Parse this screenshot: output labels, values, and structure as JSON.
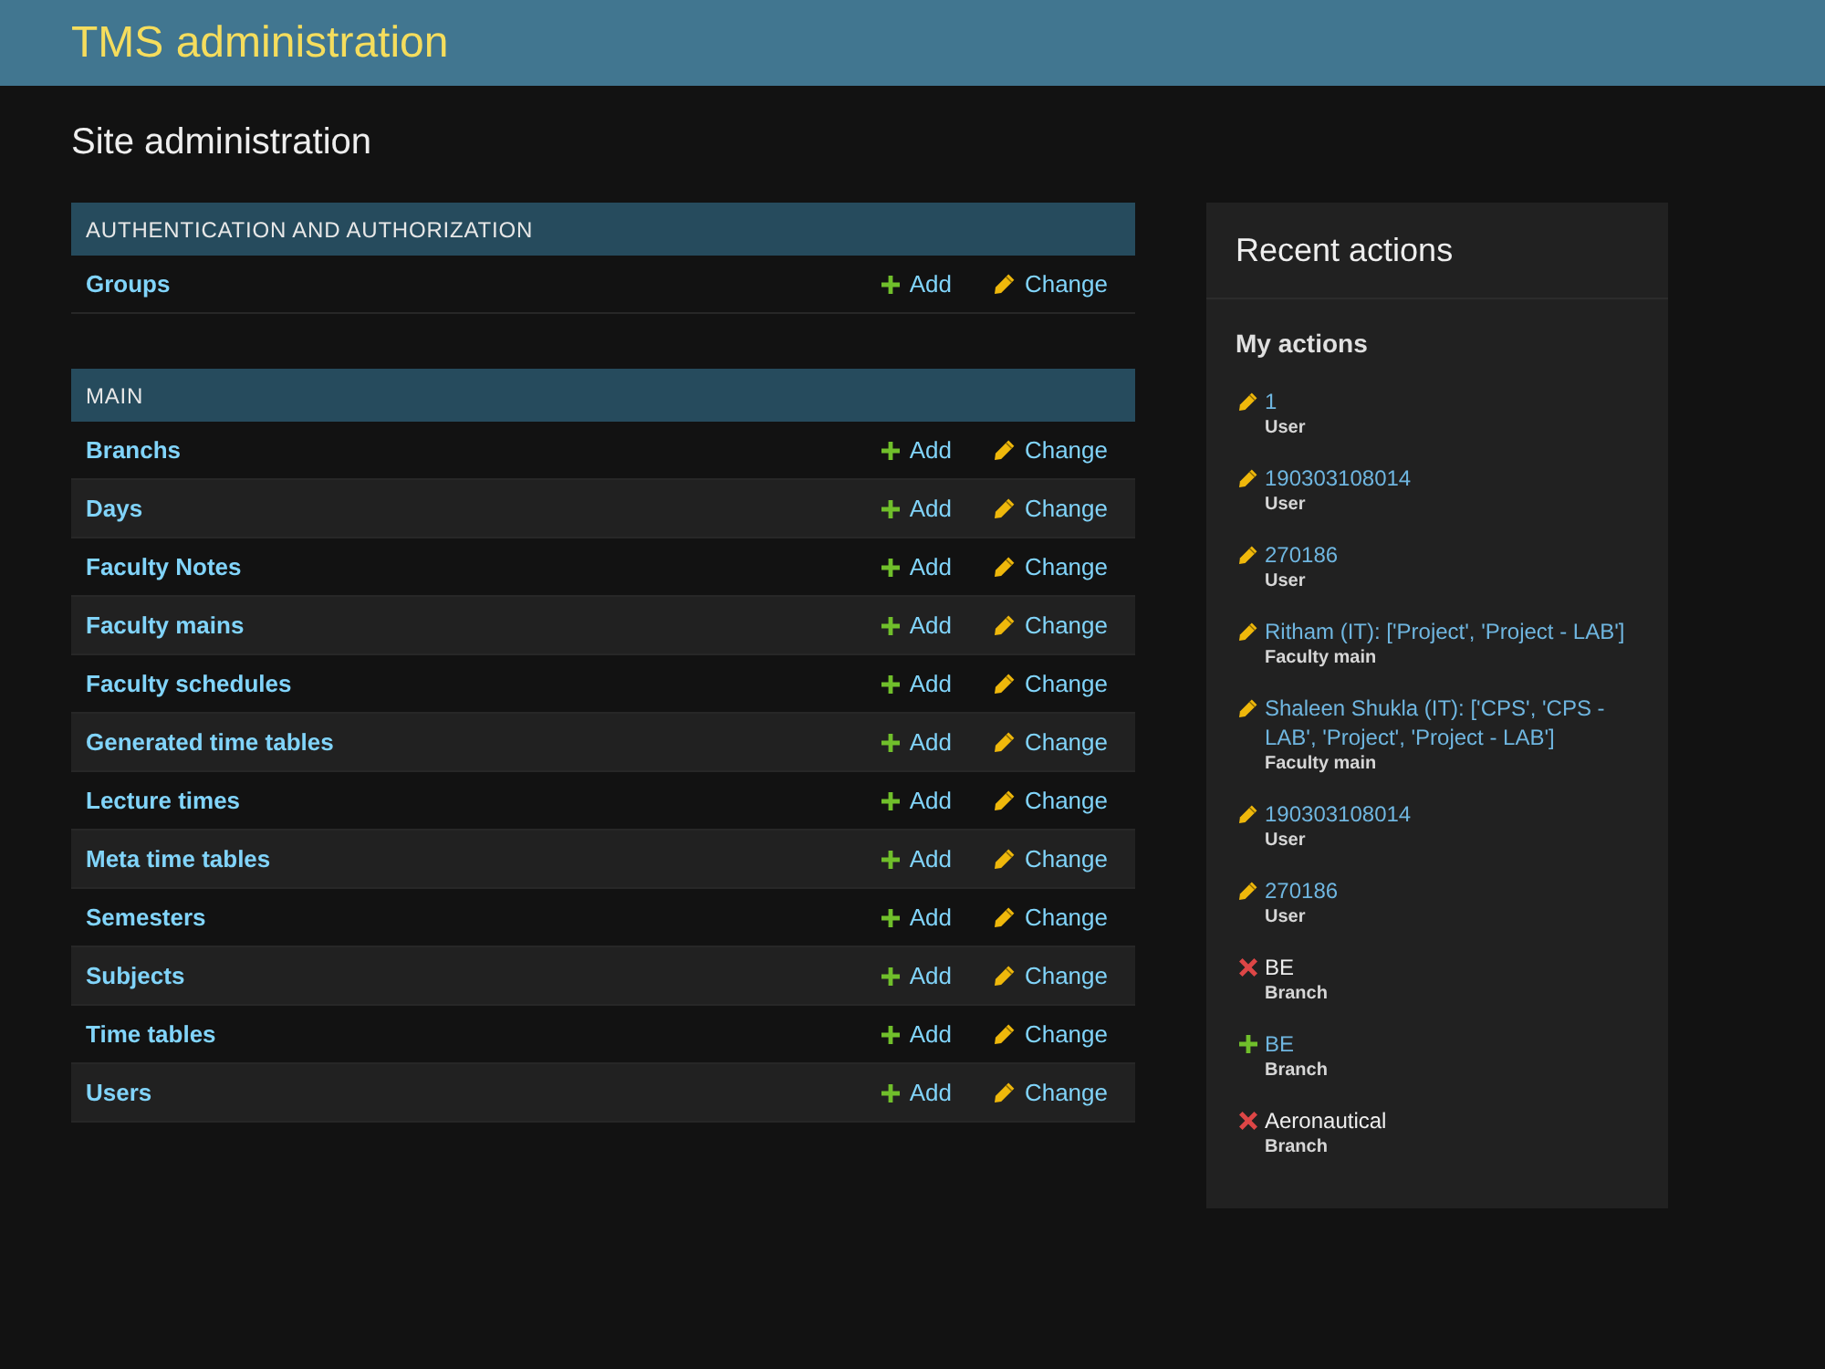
{
  "header": {
    "title": "TMS administration"
  },
  "page_title": "Site administration",
  "modules": [
    {
      "caption": "AUTHENTICATION AND AUTHORIZATION",
      "rows": [
        {
          "name": "Groups",
          "add": "Add",
          "change": "Change"
        }
      ]
    },
    {
      "caption": "MAIN",
      "rows": [
        {
          "name": "Branchs",
          "add": "Add",
          "change": "Change"
        },
        {
          "name": "Days",
          "add": "Add",
          "change": "Change"
        },
        {
          "name": "Faculty Notes",
          "add": "Add",
          "change": "Change"
        },
        {
          "name": "Faculty mains",
          "add": "Add",
          "change": "Change"
        },
        {
          "name": "Faculty schedules",
          "add": "Add",
          "change": "Change"
        },
        {
          "name": "Generated time tables",
          "add": "Add",
          "change": "Change"
        },
        {
          "name": "Lecture times",
          "add": "Add",
          "change": "Change"
        },
        {
          "name": "Meta time tables",
          "add": "Add",
          "change": "Change"
        },
        {
          "name": "Semesters",
          "add": "Add",
          "change": "Change"
        },
        {
          "name": "Subjects",
          "add": "Add",
          "change": "Change"
        },
        {
          "name": "Time tables",
          "add": "Add",
          "change": "Change"
        },
        {
          "name": "Users",
          "add": "Add",
          "change": "Change"
        }
      ]
    }
  ],
  "recent_actions": {
    "title": "Recent actions",
    "subtitle": "My actions",
    "items": [
      {
        "kind": "change",
        "label": "1",
        "type": "User"
      },
      {
        "kind": "change",
        "label": "190303108014",
        "type": "User"
      },
      {
        "kind": "change",
        "label": "270186",
        "type": "User"
      },
      {
        "kind": "change",
        "label": "Ritham (IT): ['Project', 'Project - LAB']",
        "type": "Faculty main"
      },
      {
        "kind": "change",
        "label": "Shaleen Shukla (IT): ['CPS', 'CPS - LAB', 'Project', 'Project - LAB']",
        "type": "Faculty main"
      },
      {
        "kind": "change",
        "label": "190303108014",
        "type": "User"
      },
      {
        "kind": "change",
        "label": "270186",
        "type": "User"
      },
      {
        "kind": "deletion",
        "label": "BE",
        "type": "Branch"
      },
      {
        "kind": "addition",
        "label": "BE",
        "type": "Branch"
      },
      {
        "kind": "deletion",
        "label": "Aeronautical",
        "type": "Branch"
      }
    ]
  }
}
